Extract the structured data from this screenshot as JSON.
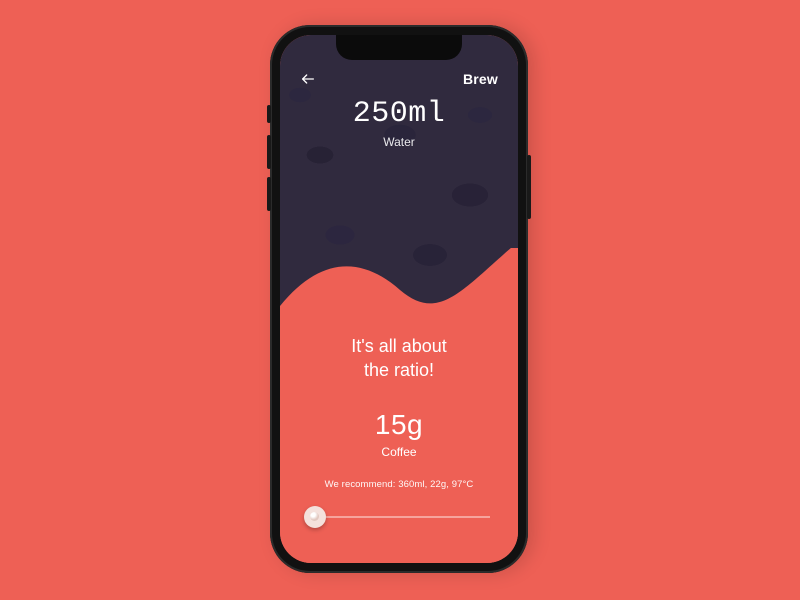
{
  "colors": {
    "accent": "#ee6055",
    "dark": "#302a3e",
    "text": "#ffffff"
  },
  "header": {
    "back_icon": "arrow-left",
    "action_label": "Brew"
  },
  "water": {
    "value": "250ml",
    "label": "Water"
  },
  "headline": {
    "line1": "It's all about",
    "line2": "the ratio!"
  },
  "coffee": {
    "value": "15g",
    "label": "Coffee"
  },
  "recommendation": "We recommend: 360ml, 22g, 97°C",
  "slider": {
    "min": 0,
    "max": 100,
    "value": 4
  }
}
